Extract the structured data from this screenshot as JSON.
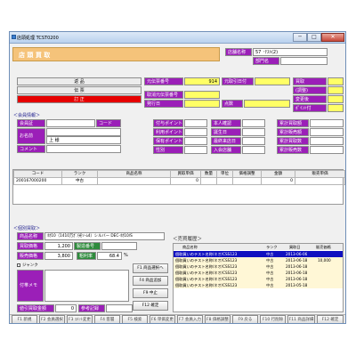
{
  "window": {
    "title": "店頭処理 TCST0200",
    "min": "─",
    "max": "□",
    "close": "✕"
  },
  "colors": {
    "label_purple": "#9b1fb8",
    "accent_orange": "#f5c37a",
    "title_bar": "#dce9f7",
    "yellow_field": "#ffff66",
    "history_selected": "#1010c0"
  },
  "header": {
    "screen_title": "店 頭 買 取",
    "store_name_label": "店舗名称",
    "store_name_value": "57 ･ﾃｽﾄ(2)",
    "slip_kind_label": "部門名"
  },
  "mode_buttons": {
    "return": "返 品",
    "slip": "伝 票",
    "correct": "訂 正"
  },
  "info_labels": {
    "orig_slip_label": "元伝票番号",
    "orig_slip_value": "914",
    "orig_date_label": "元取引日付",
    "cancel_slip_label": "取消元伝票番号",
    "issue_date_label": "発行日",
    "point_label": "点数",
    "purchase_label": "買取",
    "adjust_label": "(調整)",
    "change_label": "変更後",
    "tax_label": "ﾎﾟｲﾝﾄ付"
  },
  "member": {
    "section_label": "＜会員情報＞",
    "member_no_label": "会員証",
    "code_label": "コード",
    "name_label": "お名前",
    "name_value": "上  様",
    "comment_label": "コメント",
    "points_label": "付与ポイント",
    "use_points_label": "利用ポイント",
    "possess_points_label": "保有ポイント",
    "gender_label": "性別",
    "auth_label": "本人確認",
    "birthday_label": "誕生日",
    "last_visit_label": "最終来店日",
    "join_label": "入会店舗",
    "cum_buy_label": "累計買取額",
    "cum_sell_label": "累計販売額",
    "cum_buy_cnt_label": "累計買取数",
    "cum_sell_cnt_label": "累計販売数"
  },
  "items_table": {
    "columns": [
      "コード",
      "ランク",
      "商品名称",
      "買取単価",
      "数量",
      "単位",
      "価格調整",
      "金額",
      "販売単価"
    ],
    "rows": [
      {
        "code": "200167000200",
        "rank": "中古",
        "name": "",
        "unit_price": "0",
        "qty": "",
        "unit": "",
        "adjust": "",
        "amount": "0",
        "sell_price": ""
      }
    ]
  },
  "detail": {
    "section_label": "＜個別買取＞",
    "product_name_label": "商品名称",
    "product_name_value": "ﾈｵ10（1410万ｶﾞ/光ｿｰﾑ4）シルバー DEC-ﾈｵ10/S",
    "buy_price_label": "買取価格",
    "buy_price_value": "1,200",
    "standard_label": "製造番号",
    "sell_price_label": "販売価格",
    "sell_price_value": "3,800",
    "rate_label": "粗利率",
    "rate_value": "68.4",
    "rate_unit": "%",
    "memo_label": "付帯メモ",
    "junk_label": "ジャンク",
    "discount_label": "値引買取金額",
    "discount_value": "0",
    "ref_label": "参考記録"
  },
  "action_buttons": {
    "f1": "F1 商品選択へ",
    "f4": "F4 商品追加",
    "f9": "F9 中止",
    "f12": "F12 確定"
  },
  "history": {
    "title": "＜売買履歴＞",
    "columns": [
      "商品名称",
      "ランク",
      "買取日",
      "販売価格"
    ],
    "rows": [
      {
        "name": "個取買いのテスト名称/ネオ/CSS123",
        "rank": "中古",
        "date": "2013-06-06",
        "price": ""
      },
      {
        "name": "個取買いのテスト名称/ネオ/CSS123",
        "rank": "中古",
        "date": "2013-06-18",
        "price": "10,000"
      },
      {
        "name": "個取買いのテスト名称/ネオ/CSS123",
        "rank": "中古",
        "date": "2013-06-18",
        "price": ""
      },
      {
        "name": "個取買いのテスト名称/ネオ/CSS123",
        "rank": "中古",
        "date": "2013-06-18",
        "price": ""
      },
      {
        "name": "個取買いのテスト名称/ネオ/CSS123",
        "rank": "中古",
        "date": "2013-06-18",
        "price": ""
      },
      {
        "name": "個取買いのテスト名称/ネオ/CSS123",
        "rank": "中古",
        "date": "2013-05-18",
        "price": ""
      }
    ]
  },
  "fkeys": [
    "F1 新規",
    "F2 会員選択",
    "F3 ｺﾒﾝﾄ変更",
    "F4 客層",
    "F5 検索",
    "F6 単価変更",
    "F7 会員入力",
    "F8 価格調整",
    "F9 戻る",
    "F10 行削除",
    "F11 商品詳細",
    "F12 確定"
  ]
}
